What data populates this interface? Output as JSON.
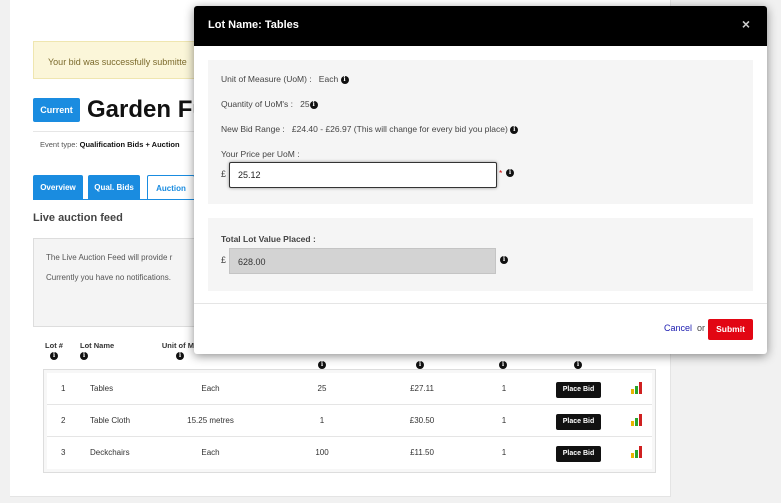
{
  "alert": {
    "text": "Your bid was successfully submitte"
  },
  "header": {
    "badge": "Current",
    "title": "Garden Fu",
    "event_type_label": "Event type:",
    "event_type_value": "Qualification Bids + Auction"
  },
  "tabs": [
    {
      "label": "Overview"
    },
    {
      "label": "Qual. Bids"
    },
    {
      "label": "Auction"
    }
  ],
  "feed": {
    "title": "Live auction feed",
    "line1": "The Live Auction Feed will provide r",
    "line2": "Currently you have no notifications."
  },
  "table": {
    "headers": {
      "lot_num": "Lot #",
      "lot_name": "Lot Name",
      "uom": "Unit of Me"
    },
    "place_bid_label": "Place Bid",
    "rows": [
      {
        "num": "1",
        "name": "Tables",
        "uom": "Each",
        "qty": "25",
        "price": "£27.11",
        "rank": "1"
      },
      {
        "num": "2",
        "name": "Table Cloth",
        "uom": "15.25 metres",
        "qty": "1",
        "price": "£30.50",
        "rank": "1"
      },
      {
        "num": "3",
        "name": "Deckchairs",
        "uom": "Each",
        "qty": "100",
        "price": "£11.50",
        "rank": "1"
      }
    ]
  },
  "modal": {
    "title": "Lot Name: Tables",
    "close": "×",
    "uom_label": "Unit of Measure (UoM) :",
    "uom_value": "Each",
    "qty_label": "Quantity of UoM's :",
    "qty_value": "25",
    "range_label": "New Bid Range :",
    "range_value": "£24.40 - £26.97 (This will change for every bid you place)",
    "price_label": "Your Price per UoM :",
    "currency": "£",
    "price_value": "25.12",
    "required_mark": "*",
    "total_label": "Total Lot Value Placed :",
    "total_value": "628.00",
    "cancel": "Cancel",
    "or": "or",
    "submit": "Submit"
  },
  "icons": {
    "info": "i",
    "chart": "bar-chart-icon"
  }
}
